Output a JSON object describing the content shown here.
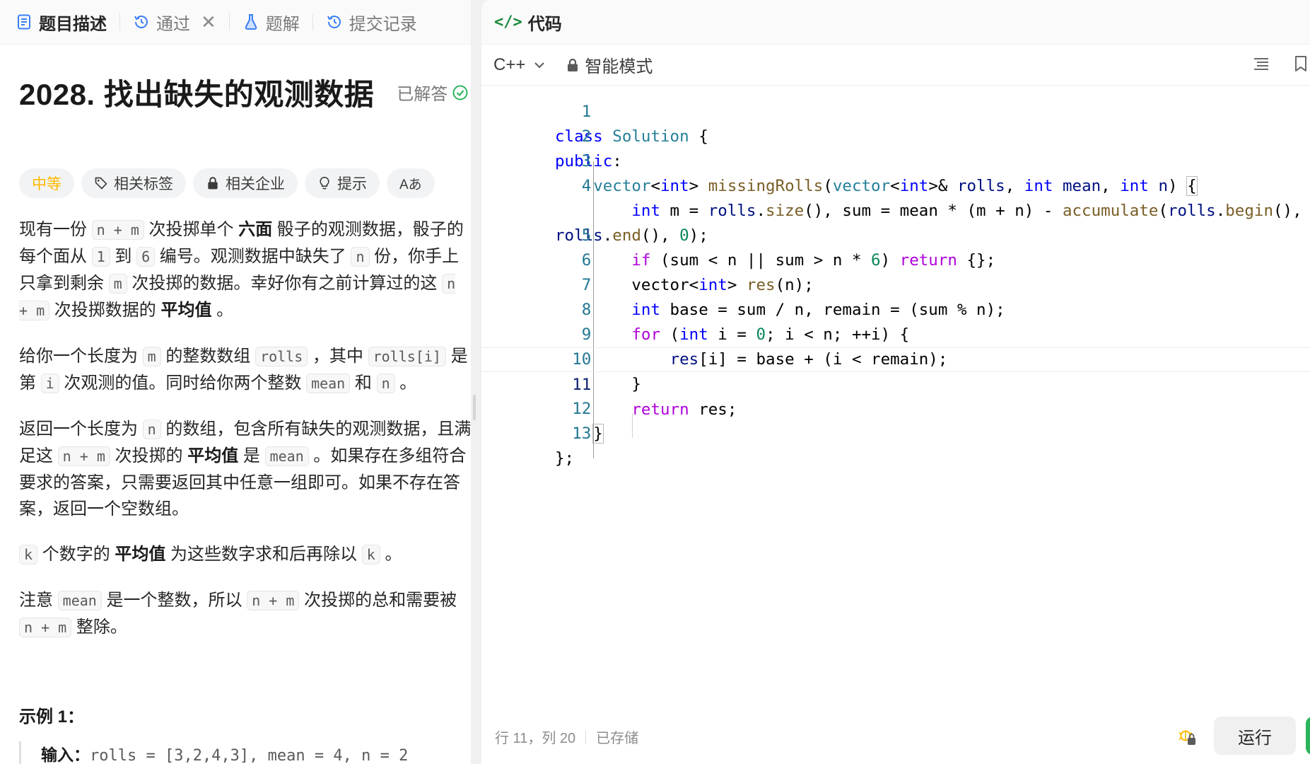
{
  "left_tabs": [
    {
      "label": "题目描述",
      "icon": "document-icon",
      "active": true
    },
    {
      "label": "通过",
      "icon": "history-icon",
      "closable": true
    },
    {
      "label": "题解",
      "icon": "flask-icon"
    },
    {
      "label": "提交记录",
      "icon": "history-icon"
    }
  ],
  "problem": {
    "title": "2028. 找出缺失的观测数据",
    "status": "已解答",
    "tags": [
      "中等",
      "相关标签",
      "相关企业",
      "提示",
      "Aあ"
    ]
  },
  "description": {
    "p1": [
      "现有一份 ",
      "n + m",
      " 次投掷单个 ",
      "六面",
      " 骰子的观测数据，骰子的每个面从 ",
      "1",
      " 到 ",
      "6",
      " 编号。观测数据中缺失了 ",
      "n",
      " 份，你手上只拿到剩余 ",
      "m",
      " 次投掷的数据。幸好你有之前计算过的这 ",
      "n + m",
      " 次投掷数据的 ",
      "平均值",
      " 。"
    ],
    "p2": [
      "给你一个长度为 ",
      "m",
      " 的整数数组 ",
      "rolls",
      " ，其中 ",
      "rolls[i]",
      " 是第 ",
      "i",
      " 次观测的值。同时给你两个整数 ",
      "mean",
      " 和 ",
      "n",
      " 。"
    ],
    "p3": [
      "返回一个长度为 ",
      "n",
      " 的数组，包含所有缺失的观测数据，且满足这 ",
      "n + m",
      " 次投掷的 ",
      "平均值",
      " 是 ",
      "mean",
      " 。如果存在多组符合要求的答案，只需要返回其中任意一组即可。如果不存在答案，返回一个空数组。"
    ],
    "p4": [
      "k",
      " 个数字的 ",
      "平均值",
      " 为这些数字求和后再除以 ",
      "k",
      " 。"
    ],
    "p5": [
      "注意 ",
      "mean",
      " 是一个整数，所以 ",
      "n + m",
      " 次投掷的总和需要被 ",
      "n + m",
      " 整除。"
    ]
  },
  "example": {
    "title": "示例 1：",
    "input_label": "输入：",
    "input_value": "rolls = [3,2,4,3], mean = 4, n = 2"
  },
  "code_panel": {
    "title": "代码",
    "language": "C++",
    "mode": "智能模式"
  },
  "code_lines": [
    "class Solution {",
    "public:",
    "    vector<int> missingRolls(vector<int>& rolls, int mean, int n) {",
    "        int m = rolls.size(), sum = mean * (m + n) - accumulate(rolls.begin(),",
    "rolls.end(), 0);",
    "        if (sum < n || sum > n * 6) return {};",
    "        vector<int> res(n);",
    "        int base = sum / n, remain = (sum % n);",
    "        for (int i = 0; i < n; ++i) {",
    "            res[i] = base + (i < remain);",
    "        }",
    "        return res;",
    "    }",
    "};"
  ],
  "line_numbers": [
    "1",
    "2",
    "3",
    "4",
    "",
    "5",
    "6",
    "7",
    "8",
    "9",
    "10",
    "11",
    "12",
    "13"
  ],
  "status": {
    "cursor": "行 11，列 20",
    "saved": "已存储",
    "run_label": "运行"
  },
  "colors": {
    "keyword_blue": "#0000ff",
    "keyword_purple": "#af00db",
    "type": "#267f99",
    "function": "#795e26",
    "number": "#098658",
    "identifier": "#001080",
    "line_number": "#237893",
    "difficulty_medium": "#ffb800",
    "solved_green": "#2db55d"
  }
}
